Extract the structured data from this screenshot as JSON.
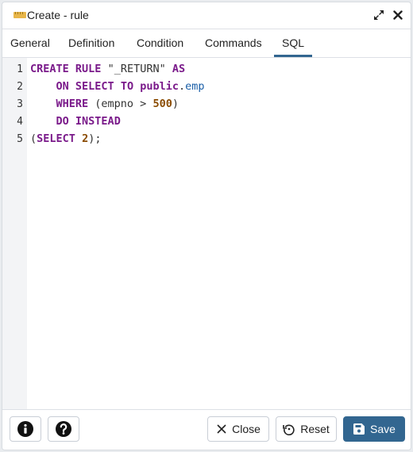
{
  "dialog": {
    "title": "Create - rule",
    "title_icon": "rule-icon",
    "expand_icon": "expand-icon",
    "close_icon": "close-icon"
  },
  "tabs": [
    {
      "label": "General",
      "active": false
    },
    {
      "label": "Definition",
      "active": false
    },
    {
      "label": "Condition",
      "active": false
    },
    {
      "label": "Commands",
      "active": false
    },
    {
      "label": "SQL",
      "active": true
    }
  ],
  "sql": {
    "line_numbers": [
      "1",
      "2",
      "3",
      "4",
      "5"
    ],
    "lines": [
      "CREATE RULE \"_RETURN\" AS",
      "    ON SELECT TO public.emp",
      "    WHERE (empno > 500)",
      "    DO INSTEAD",
      "(SELECT 2);"
    ]
  },
  "footer": {
    "info_icon": "info-icon",
    "help_icon": "help-icon",
    "close_label": "Close",
    "reset_label": "Reset",
    "save_label": "Save"
  },
  "colors": {
    "accent": "#326690"
  }
}
